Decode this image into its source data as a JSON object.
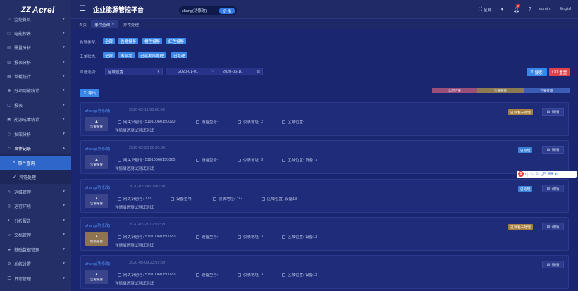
{
  "brand": {
    "logo_text": "Acrel",
    "logo_mark": "ZZ"
  },
  "header": {
    "title": "企业能源管控平台",
    "user": "zhang(功修改)",
    "switch_label": "切 换",
    "fullscreen_label": "全屏",
    "notification_count": "0",
    "account_label": "admin",
    "language_label": "English"
  },
  "sidebar": {
    "items": [
      {
        "label": "监控首页",
        "icon": "home-icon"
      },
      {
        "label": "电能抄表",
        "icon": "meter-icon"
      },
      {
        "label": "需量分析",
        "icon": "chart-icon"
      },
      {
        "label": "报表分析",
        "icon": "report-icon"
      },
      {
        "label": "单耗统计",
        "icon": "stats-icon"
      },
      {
        "label": "分项用能统计",
        "icon": "split-icon"
      },
      {
        "label": "报表",
        "icon": "doc-icon"
      },
      {
        "label": "能源成本统计",
        "icon": "cost-icon"
      },
      {
        "label": "损效分析",
        "icon": "loss-icon"
      },
      {
        "label": "事件记录",
        "icon": "warning-icon"
      },
      {
        "label": "运维管理",
        "icon": "tools-icon"
      },
      {
        "label": "运行环境",
        "icon": "env-icon"
      },
      {
        "label": "分析报告",
        "icon": "analysis-icon"
      },
      {
        "label": "文档管理",
        "icon": "folder-icon"
      },
      {
        "label": "基础数据管理",
        "icon": "database-icon"
      },
      {
        "label": "系统设置",
        "icon": "gear-icon"
      },
      {
        "label": "日志管理",
        "icon": "log-icon"
      }
    ],
    "subitems": [
      {
        "label": "事件查询",
        "icon": "search-icon",
        "active": true
      },
      {
        "label": "异常处理",
        "icon": "check-icon",
        "active": false
      }
    ]
  },
  "tabs": [
    {
      "label": "首页"
    },
    {
      "label": "事件查询",
      "closable": true
    },
    {
      "label": "异常处理"
    }
  ],
  "filters": {
    "alarm_type_label": "告警类型:",
    "alarm_types": [
      "全部",
      "告警报警",
      "橙色报警",
      "红色报警"
    ],
    "status_label": "工单状态:",
    "statuses": [
      "全部",
      "未派发",
      "已派发未处理",
      "已处理"
    ],
    "quick_label": "筛选选项:",
    "region_placeholder": "区域位置",
    "date_start": "2020-01-01",
    "date_end": "2020-06-10",
    "search_label": "搜索",
    "reset_label": "重置",
    "export_label": "导出"
  },
  "legend": [
    "实时告警",
    "告警报警",
    "告警处理"
  ],
  "legend_colors": [
    "#9a4e7a",
    "#8c7a52",
    "#3b5db5"
  ],
  "field_labels": {
    "gateway": "网关识别号:",
    "device": "设备型号:",
    "meter": "仪表地址:",
    "region": "区域位置:"
  },
  "detail_label": "详情",
  "events": [
    {
      "user": "zhang(功修改)",
      "time": "2020-02-11 00:00:00",
      "badge": "告警报警",
      "badge_style": "normal",
      "gateway": "51910060150020",
      "device": "",
      "meter": "2",
      "region": "",
      "desc": "详情描述测试测试测试",
      "status": "已派发未处理",
      "status_style": "pending"
    },
    {
      "user": "zhang(功修改)",
      "time": "2020-02-23 00:00:00",
      "badge": "告警报警",
      "badge_style": "normal",
      "gateway": "51910060150020",
      "device": "",
      "meter": "3",
      "region": "设备13",
      "desc": "详情描述测试测试测试",
      "status": "已处理",
      "status_style": "done"
    },
    {
      "user": "zhang(功修改)",
      "time": "2020-02-24 01:00:00",
      "badge": "告警报警",
      "badge_style": "normal",
      "gateway": "777",
      "device": "",
      "meter": "312",
      "region": "设备13",
      "desc": "详情描述测试测试测试",
      "status": "已处理",
      "status_style": "done"
    },
    {
      "user": "zhang(功修改)",
      "time": "2020-02-21 02:59:59",
      "badge": "橙色报警",
      "badge_style": "orange",
      "gateway": "51910060150020",
      "device": "",
      "meter": "3",
      "region": "设备13",
      "desc": "详情描述测试测试测试",
      "status": "已派发未处理",
      "status_style": "pending"
    },
    {
      "user": "zhang(功修改)",
      "time": "2020-05-09 23:59:59",
      "badge": "告警报警",
      "badge_style": "normal",
      "gateway": "51910060150020",
      "device": "",
      "meter": "3",
      "region": "设备13",
      "desc": "详情描述测试测试测试",
      "status": "",
      "status_style": "none"
    }
  ],
  "ime": {
    "logo": "S",
    "label": "中"
  }
}
